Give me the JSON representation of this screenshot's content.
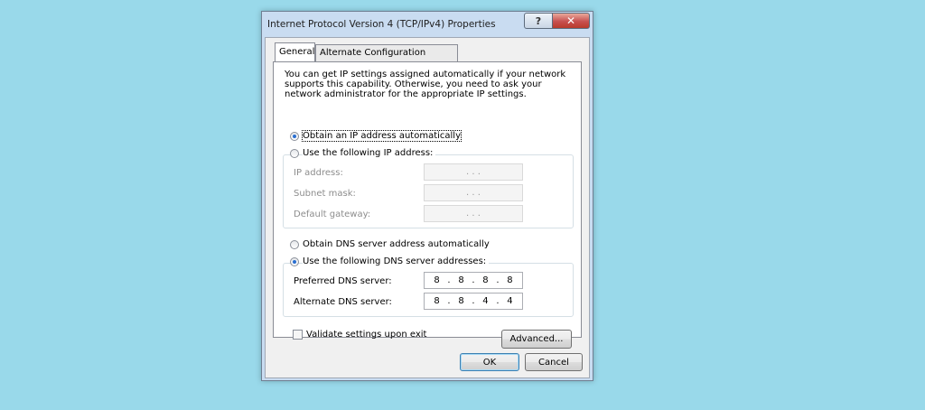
{
  "window": {
    "title": "Internet Protocol Version 4 (TCP/IPv4) Properties",
    "help_glyph": "?",
    "close_glyph": "✕"
  },
  "tabs": [
    {
      "label": "General",
      "active": true
    },
    {
      "label": "Alternate Configuration",
      "active": false
    }
  ],
  "intro_text": "You can get IP settings assigned automatically if your network supports this capability. Otherwise, you need to ask your network administrator for the appropriate IP settings.",
  "ip": {
    "auto_label": "Obtain an IP address automatically",
    "auto_selected": true,
    "manual_label": "Use the following IP address:",
    "fields": {
      "ip_address_label": "IP address:",
      "subnet_mask_label": "Subnet mask:",
      "default_gateway_label": "Default gateway:",
      "ip_address_value": ". . .",
      "subnet_mask_value": ". . .",
      "default_gateway_value": ". . ."
    }
  },
  "dns": {
    "auto_label": "Obtain DNS server address automatically",
    "manual_label": "Use the following DNS server addresses:",
    "manual_selected": true,
    "preferred_label": "Preferred DNS server:",
    "alternate_label": "Alternate DNS server:",
    "preferred_octets": [
      "8",
      "8",
      "8",
      "8"
    ],
    "alternate_octets": [
      "8",
      "8",
      "4",
      "4"
    ]
  },
  "validate_label": "Validate settings upon exit",
  "validate_checked": false,
  "buttons": {
    "advanced": "Advanced...",
    "ok": "OK",
    "cancel": "Cancel"
  },
  "colors": {
    "desktop": "#99d9ea",
    "radio_selected": "#2a6fd1",
    "close_button": "#c75050"
  }
}
